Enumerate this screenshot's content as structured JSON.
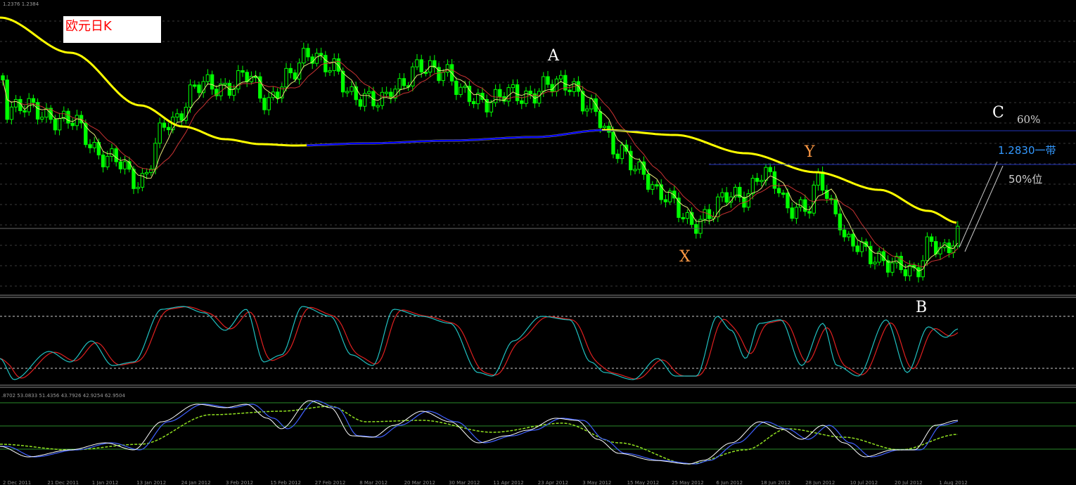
{
  "chart_data": {
    "type": "candlestick",
    "title": "欧元日K",
    "header_values": "1.2376 1.2384",
    "indicator_values": ".8702 53.0833 51.4356 43.7926 42.9254 62.9504",
    "x_tick_labels": [
      "2 Dec 2011",
      "21 Dec 2011",
      "1 Jan 2012",
      "13 Jan 2012",
      "24 Jan 2012",
      "3 Feb 2012",
      "15 Feb 2012",
      "27 Feb 2012",
      "8 Mar 2012",
      "20 Mar 2012",
      "30 Mar 2012",
      "11 Apr 2012",
      "23 Apr 2012",
      "3 May 2012",
      "15 May 2012",
      "25 May 2012",
      "6 Jun 2012",
      "18 Jun 2012",
      "28 Jun 2012",
      "10 Jul 2012",
      "20 Jul 2012",
      "1 Aug 2012"
    ],
    "annotations": {
      "A": "A",
      "B": "B",
      "C": "C",
      "X": "X",
      "Y": "Y",
      "fib60": "60%",
      "fib50": "50%位",
      "level": "1.2830一带"
    },
    "colors": {
      "background": "#000000",
      "candle": "#00ff00",
      "ma_long": "#ffff00",
      "ma_long_segment": "#0000ff",
      "ma_mid": "#c83232",
      "ma_short": "#e6e678",
      "stoch_main": "#20c0c0",
      "stoch_signal": "#e02020",
      "osc_white": "#ffffff",
      "osc_blue": "#4060ff",
      "osc_green": "#90e020",
      "level_blue_text": "#3399ff",
      "annotation_orange": "#ff9944",
      "grid": "#3a3a3a"
    },
    "stoch_levels": [
      80,
      20
    ]
  }
}
